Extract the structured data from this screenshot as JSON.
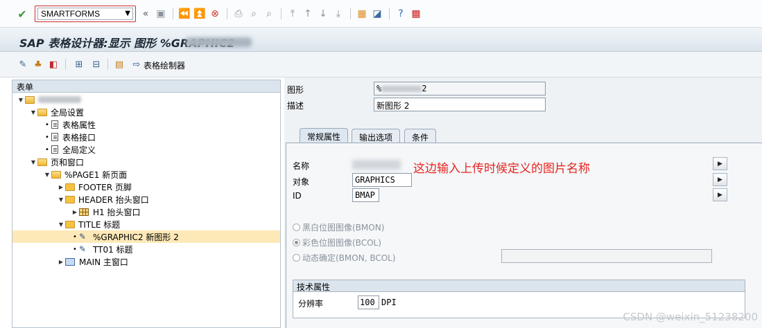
{
  "toolbar": {
    "command_value": "SMARTFORMS"
  },
  "title": {
    "text": "SAP 表格设计器:显示 图形 %GRAPHIC2"
  },
  "app_toolbar": {
    "form_painter_label": "表格绘制器"
  },
  "tree": {
    "header": "表单",
    "items": [
      {
        "label": "全局设置"
      },
      {
        "label": "表格属性"
      },
      {
        "label": "表格接口"
      },
      {
        "label": "全局定义"
      },
      {
        "label": "页和窗口"
      },
      {
        "label": "%PAGE1 新页面"
      },
      {
        "label": "FOOTER 页脚"
      },
      {
        "label": "HEADER 抬头窗口"
      },
      {
        "label": "H1 抬头窗口"
      },
      {
        "label": "TITLE 标题"
      },
      {
        "label": "%GRAPHIC2 新图形 2"
      },
      {
        "label": "TT01 标题"
      },
      {
        "label": "MAIN 主窗口"
      }
    ]
  },
  "header_fields": {
    "graphic_label": "图形",
    "graphic_value_suffix": "2",
    "graphic_value_prefix": "%",
    "desc_label": "描述",
    "desc_value": "新图形 2"
  },
  "tabs": [
    {
      "label": "常规属性"
    },
    {
      "label": "输出选项"
    },
    {
      "label": "条件"
    }
  ],
  "general": {
    "name_label": "名称",
    "object_label": "对象",
    "object_value": "GRAPHICS",
    "id_label": "ID",
    "id_value": "BMAP",
    "annotation": "这边输入上传时候定义的图片名称",
    "radio_bw": "黑白位图图像(BMON)",
    "radio_color": "彩色位图图像(BCOL)",
    "radio_dynamic": "动态确定(BMON, BCOL)"
  },
  "tech": {
    "title": "技术属性",
    "resolution_label": "分辨率",
    "resolution_value": "100",
    "resolution_unit": "DPI"
  },
  "watermark": "CSDN @weixin_51238200"
}
